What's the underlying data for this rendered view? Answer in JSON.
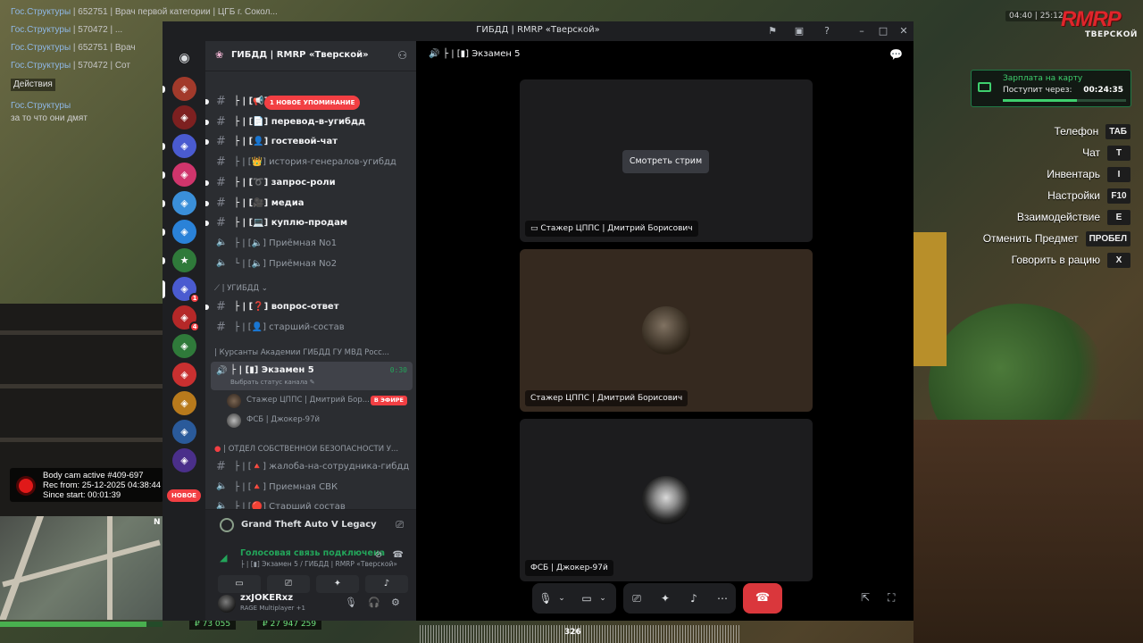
{
  "game_chat": {
    "rows": [
      {
        "tag": "Гос.Структуры",
        "text": " | 652751 | Врач первой категории | ЦГБ г. Сокол..."
      },
      {
        "tag": "Гос.Структуры",
        "text": " | 570472 | ..."
      },
      {
        "tag": "Гос.Структуры",
        "text": " | 652751 | Врач"
      },
      {
        "tag": "Гос.Структуры",
        "text": " | 570472 | Сот"
      }
    ],
    "actions_label": "Действия",
    "talk_tag": "Гос.Структуры",
    "talk_text": "за то что они дмят"
  },
  "hud": {
    "time": "04:40 | 25:12",
    "logo": "RMRP",
    "logo_sub": "ТВЕРСКОЙ",
    "salary_title": "Зарплата на карту",
    "salary_sub": "Поступит через:",
    "salary_time": "00:24:35",
    "salary_progress": 0.6,
    "keys": [
      {
        "label": "Телефон",
        "key": "TAБ"
      },
      {
        "label": "Чат",
        "key": "T"
      },
      {
        "label": "Инвентарь",
        "key": "I"
      },
      {
        "label": "Настройки",
        "key": "F10"
      },
      {
        "label": "Взаимодействие",
        "key": "E"
      },
      {
        "label": "Отменить Предмет",
        "key": "ПРОБЕЛ"
      },
      {
        "label": "Говорить в рацию",
        "key": "X"
      }
    ],
    "bodycam": {
      "line1": "Body cam active #409-697",
      "line2": "Rec from: 25-12-2025 04:38:44",
      "line3": "Since start: 00:01:39"
    },
    "money1": "₽ 73 055",
    "money2": "₽ 27 947 259",
    "audio_value": "326",
    "compass": "N"
  },
  "discord": {
    "window_title": "ГИБДД | RMRP «Тверской»",
    "server_name": "ГИБДД | RMRP «Тверской»",
    "new_mention": "1 НОВОЕ УПОМИНАНИЕ",
    "channels": [
      {
        "type": "text",
        "name": "├ | [📢]",
        "unread": true
      },
      {
        "type": "text",
        "name": "├ | [📄] перевод-в-угибдд",
        "unread": true
      },
      {
        "type": "text",
        "name": "├ | [👤] гостевой-чат",
        "unread": true
      },
      {
        "type": "text",
        "name": "├ | [👑] история-генералов-угибдд",
        "unread": false
      },
      {
        "type": "text",
        "name": "├ | [➰] запрос-роли",
        "unread": true
      },
      {
        "type": "text",
        "name": "├ | [🎥] медиа",
        "unread": true
      },
      {
        "type": "text",
        "name": "├ | [💻] куплю-продам",
        "unread": true
      },
      {
        "type": "voice",
        "name": "├ | [🔈] Приёмная No1",
        "unread": false
      },
      {
        "type": "voice",
        "name": "└ | [🔈] Приёмная No2",
        "unread": false
      }
    ],
    "category_ugibdd": "⟋ | УГИБДД ⌄",
    "channels2": [
      {
        "type": "text",
        "name": "├ | [❓] вопрос-ответ",
        "unread": true
      },
      {
        "type": "text",
        "name": "├ | [👤] старший-состав",
        "unread": false
      }
    ],
    "category_academy": "| Курсанты Академии ГИБДД ГУ МВД Росс...",
    "active_voice": {
      "name": "├ | [▮] Экзамен 5",
      "timer": "0:30",
      "status": "Выбрать статус канала ✎"
    },
    "voice_users": [
      {
        "name": "Стажер ЦППС | Дмитрий Бор...",
        "live": "В ЭФИРЕ"
      },
      {
        "name": "ФСБ | Джокер-97й",
        "live": ""
      }
    ],
    "category_osb": "| ОТДЕЛ СОБСТВЕННОЙ БЕЗОПАСНОСТИ У...",
    "channels3": [
      {
        "type": "text",
        "name": "├ | [🔺] жалоба-на-сотрудника-гибдд",
        "unread": false
      },
      {
        "type": "voice",
        "name": "├ | [🔺] Приемная СВК",
        "unread": false
      },
      {
        "type": "voice",
        "name": "├ | [🔴] Старший состав",
        "unread": false
      }
    ],
    "new_badge": "НОВОЕ",
    "game_activity": "Grand Theft Auto V Legacy",
    "voice_connected": "Голосовая связь подключена",
    "voice_location": "├ | [▮] Экзамен 5 / ГИБДД | RMRP «Тверской»",
    "user_name": "zxJOKERxz",
    "user_status": "RAGE Multiplayer +1",
    "main_channel": "├ | [▮] Экзамен 5",
    "tiles": [
      {
        "label": "Стажер ЦППС | Дмитрий Борисович",
        "button": "Смотреть стрим"
      },
      {
        "label": "Стажер ЦППС | Дмитрий Борисович"
      },
      {
        "label": "ФСБ | Джокер-97й"
      }
    ]
  }
}
